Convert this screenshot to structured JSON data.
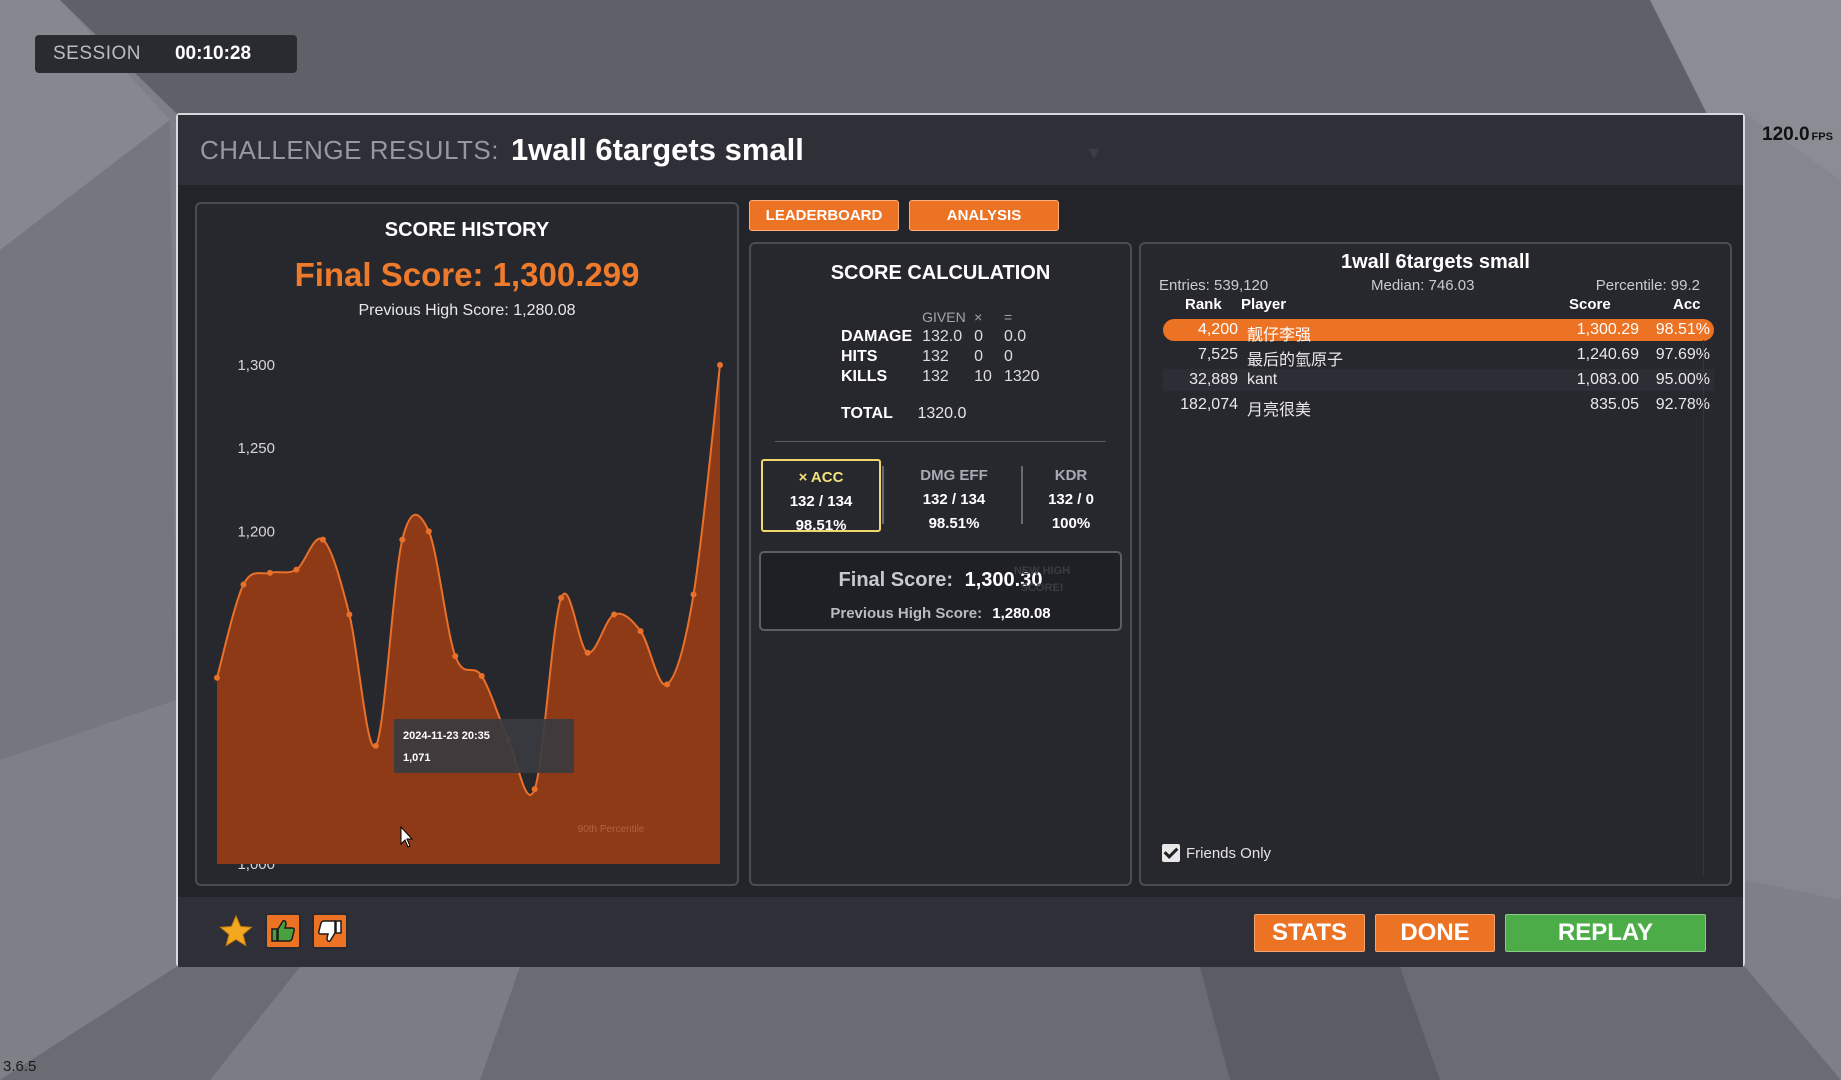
{
  "session": {
    "label": "SESSION",
    "time": "00:10:28"
  },
  "fps": {
    "value": "120.0",
    "unit": "FPS"
  },
  "version": "3.6.5",
  "title": {
    "label": "CHALLENGE RESULTS:",
    "scenario": "1wall 6targets small"
  },
  "score_history": {
    "title": "SCORE HISTORY",
    "final_score": "Final Score: 1,300.299",
    "previous_high": "Previous High Score: 1,280.08",
    "tooltip": {
      "date": "2024-11-23 20:35",
      "value": "1,071"
    },
    "percentile_label": "90th Percentile"
  },
  "chart_data": {
    "type": "area",
    "title": "SCORE HISTORY",
    "ylim": [
      1000,
      1300
    ],
    "yticks": [
      1000,
      1050,
      1100,
      1150,
      1200,
      1250,
      1300
    ],
    "ytick_labels": [
      "1,000",
      "1,050",
      "1,100",
      "1,150",
      "1,200",
      "1,250",
      "1,300"
    ],
    "grid": false,
    "values": [
      1112,
      1168,
      1175,
      1177,
      1195,
      1150,
      1071,
      1195,
      1200,
      1125,
      1113,
      1075,
      1045,
      1160,
      1127,
      1150,
      1140,
      1108,
      1162,
      1300
    ],
    "colors": {
      "fill": "#8e3a17",
      "line": "#e8702a",
      "point": "#e8702a"
    }
  },
  "tabs": [
    {
      "label": "LEADERBOARD"
    },
    {
      "label": "ANALYSIS"
    }
  ],
  "calc": {
    "title": "SCORE CALCULATION",
    "headers": [
      "GIVEN",
      "×",
      "="
    ],
    "rows": [
      {
        "label": "DAMAGE",
        "given": "132.0",
        "mult": "0",
        "result": "0.0"
      },
      {
        "label": "HITS",
        "given": "132",
        "mult": "0",
        "result": "0"
      },
      {
        "label": "KILLS",
        "given": "132",
        "mult": "10",
        "result": "1320"
      }
    ],
    "total": {
      "label": "TOTAL",
      "value": "1320.0"
    },
    "metrics": {
      "acc": {
        "label": "× ACC",
        "ratio": "132 / 134",
        "pct": "98.51%"
      },
      "dmg": {
        "label": "DMG EFF",
        "ratio": "132 / 134",
        "pct": "98.51%"
      },
      "kdr": {
        "label": "KDR",
        "ratio": "132 / 0",
        "pct": "100%"
      }
    },
    "final": {
      "label": "Final Score:",
      "value": "1,300.30",
      "prev_label": "Previous High Score:",
      "prev_value": "1,280.08",
      "new_high": "NEW HIGH SCORE!"
    }
  },
  "leaderboard": {
    "title": "1wall 6targets small",
    "entries": "Entries: 539,120",
    "median": "Median: 746.03",
    "percentile": "Percentile: 99.2",
    "columns": {
      "rank": "Rank",
      "player": "Player",
      "score": "Score",
      "acc": "Acc"
    },
    "rows": [
      {
        "rank": "4,200",
        "player": "靓仔李强",
        "score": "1,300.29",
        "acc": "98.51%"
      },
      {
        "rank": "7,525",
        "player": "最后的氫原子",
        "score": "1,240.69",
        "acc": "97.69%"
      },
      {
        "rank": "32,889",
        "player": "kant",
        "score": "1,083.00",
        "acc": "95.00%"
      },
      {
        "rank": "182,074",
        "player": "月亮很美",
        "score": "835.05",
        "acc": "92.78%"
      }
    ],
    "friends_only": "Friends Only"
  },
  "footer": {
    "stats": "STATS",
    "done": "DONE",
    "replay": "REPLAY"
  },
  "icons": {
    "favorite": "star-icon",
    "like": "thumbs-up-icon",
    "dislike": "thumbs-down-icon"
  },
  "colors": {
    "accent": "#ec7224",
    "replay": "#4cad48",
    "acc_highlight": "#f0d66b"
  }
}
